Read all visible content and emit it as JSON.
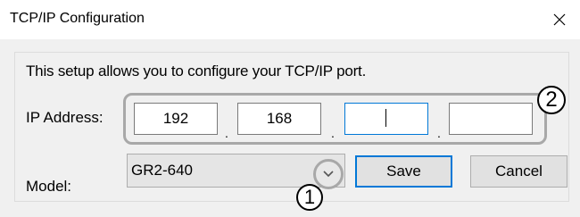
{
  "window": {
    "title": "TCP/IP Configuration",
    "close_icon": "close-icon"
  },
  "intro_text": "This setup allows you to configure your TCP/IP port.",
  "ip": {
    "label": "IP Address:",
    "octets": [
      "192",
      "168",
      "",
      ""
    ],
    "separator": ".",
    "focused_octet_index": 2
  },
  "model": {
    "label": "Model:",
    "selected": "GR2-640",
    "dropdown_icon": "chevron-down-icon"
  },
  "buttons": {
    "save": "Save",
    "cancel": "Cancel"
  },
  "callouts": {
    "one": "1",
    "two": "2"
  },
  "colors": {
    "focus_accent": "#0078d7",
    "callout_outline": "#a8a8a8",
    "dialog_background": "#f0f0f0"
  }
}
